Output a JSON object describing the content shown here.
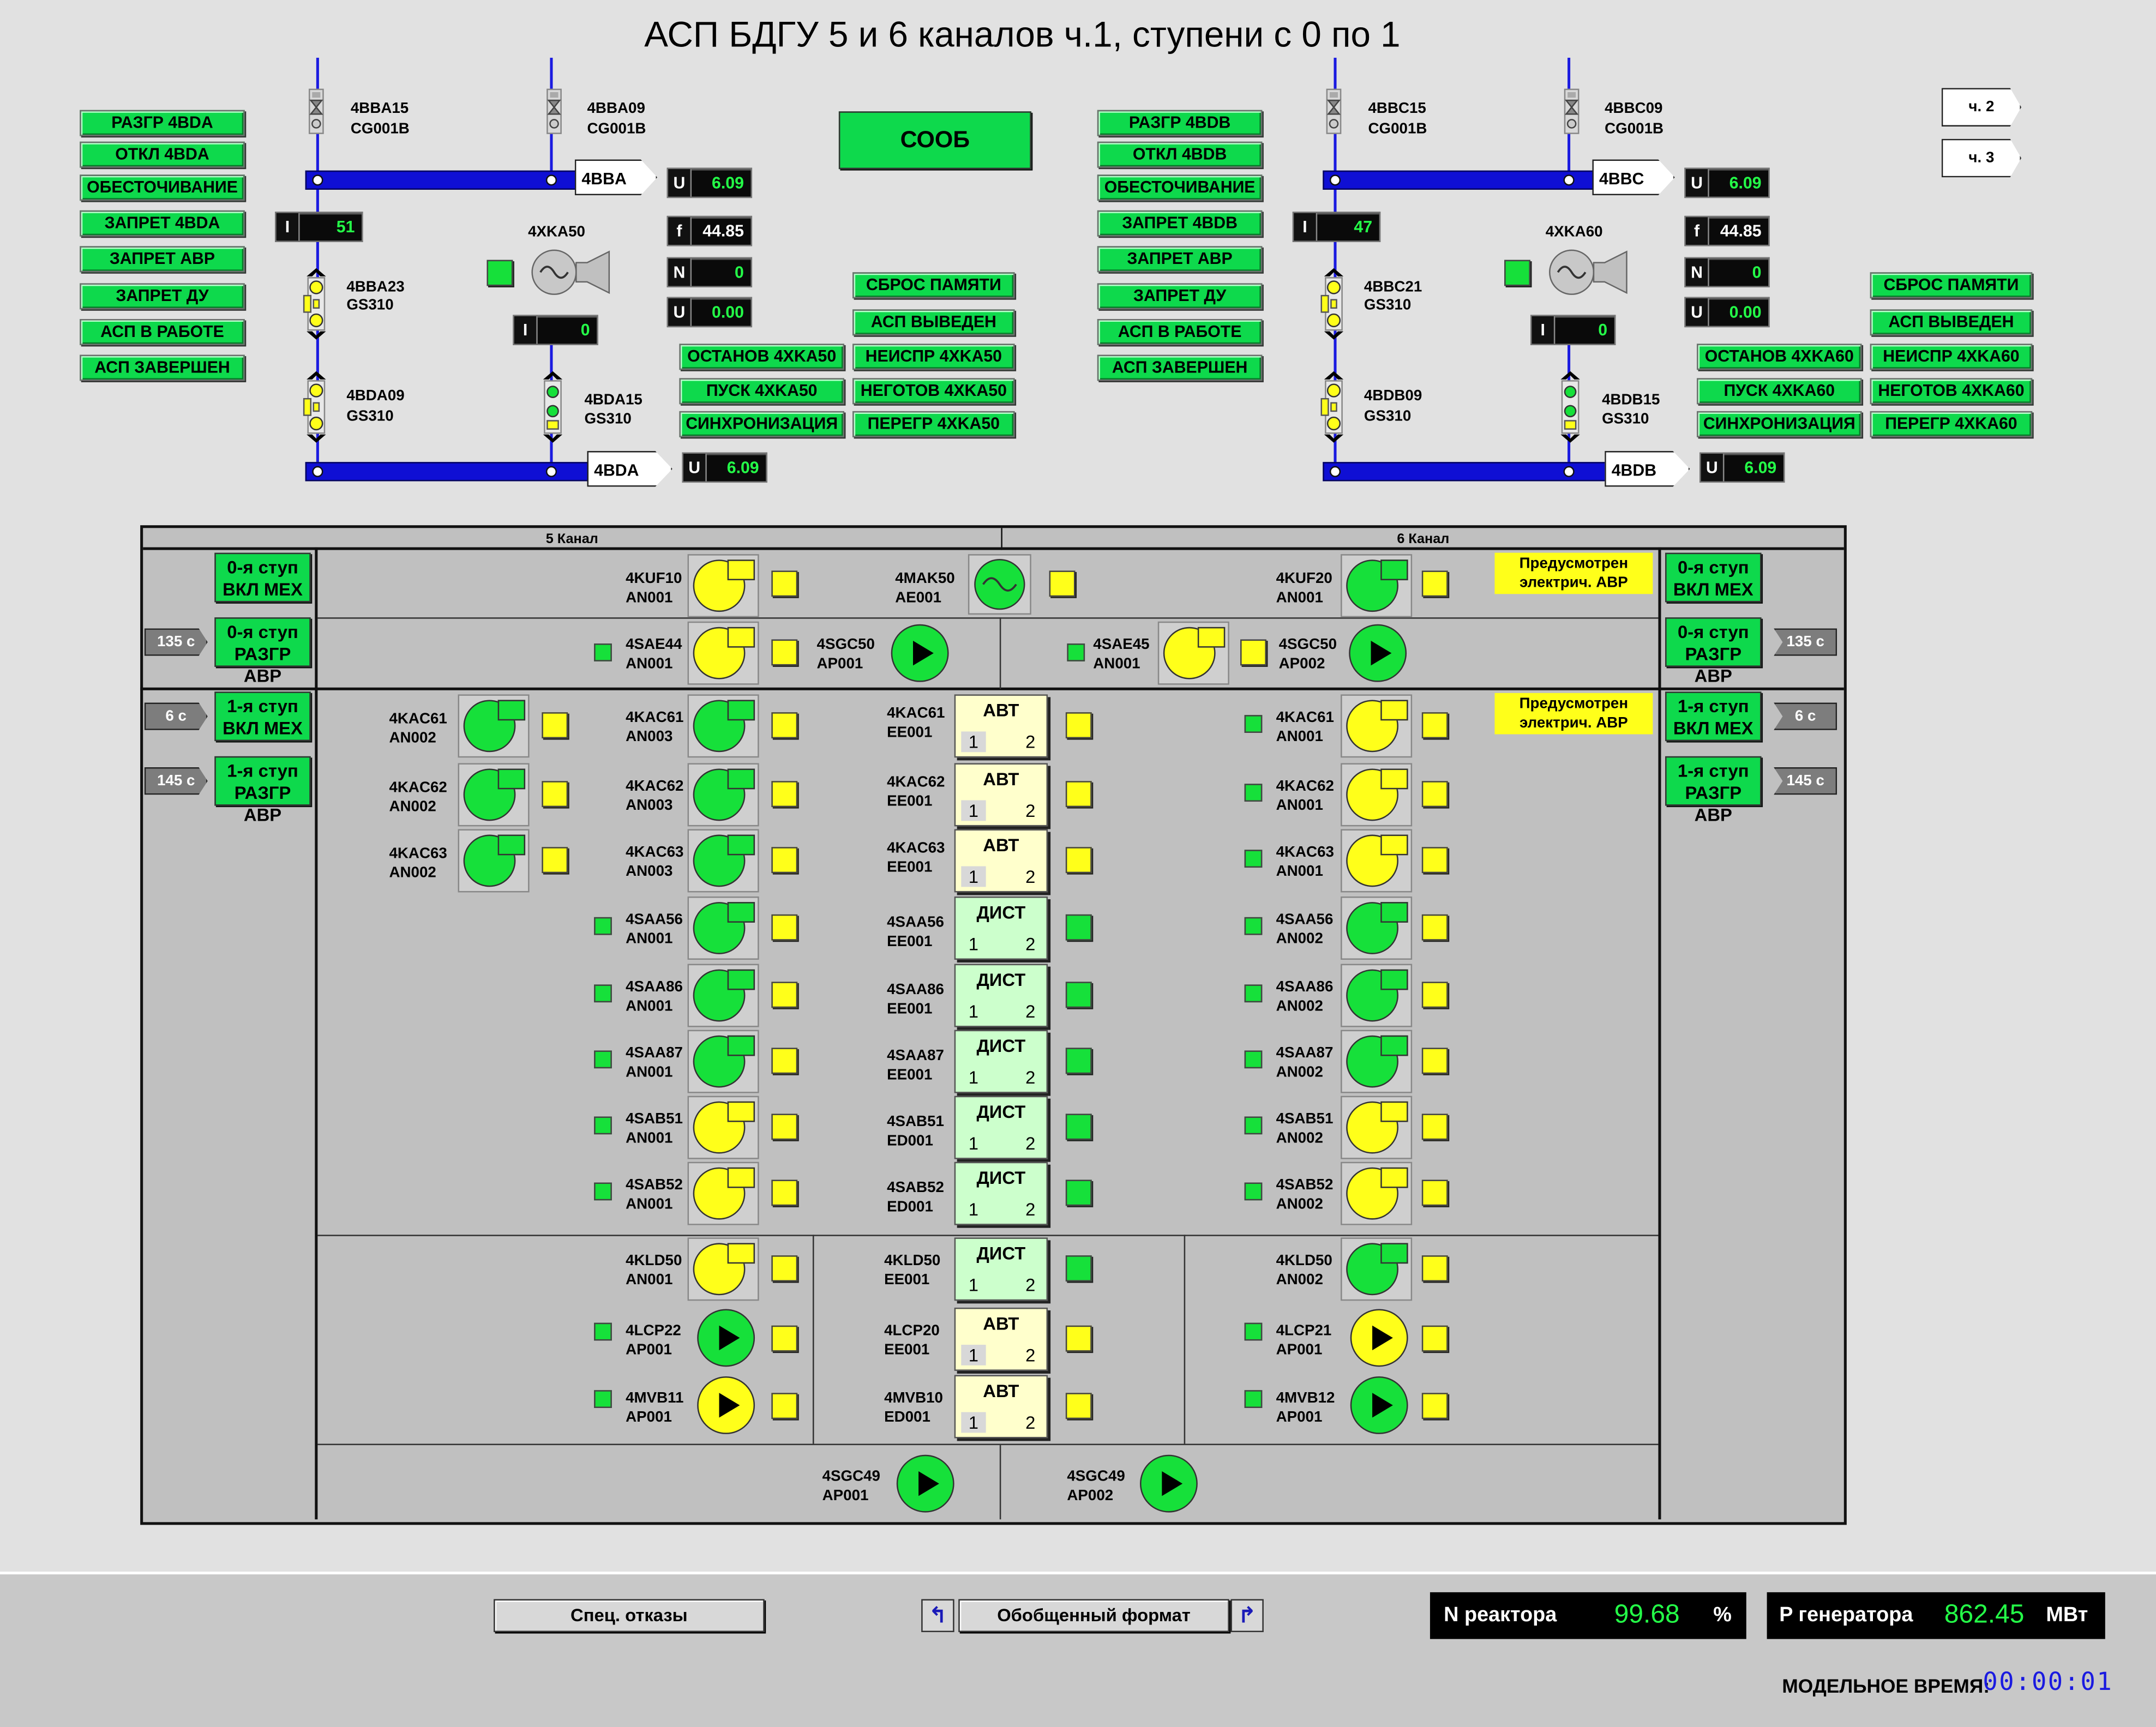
{
  "title": "АСП БДГУ 5 и 6 каналов ч.1, ступени с 0 по 1",
  "sooob": "СООБ",
  "nav": {
    "ch2": "ч. 2",
    "ch3": "ч. 3"
  },
  "left": {
    "buttons": [
      "РАЗГР 4BDA",
      "ОТКЛ 4BDA",
      "ОБЕСТОЧИВАНИЕ",
      "ЗАПРЕТ 4BDA",
      "ЗАПРЕТ АВР",
      "ЗАПРЕТ ДУ",
      "АСП В РАБОТЕ",
      "АСП ЗАВЕРШЕН"
    ],
    "v1": {
      "name": "4BBA15",
      "code": "CG001B"
    },
    "v2": {
      "name": "4BBA09",
      "code": "CG001B"
    },
    "bus_top": "4BBA",
    "bus_bot": "4BDA",
    "U_top": "6.09",
    "U_bot": "6.09",
    "I_left": "51",
    "I_gen": "0",
    "f": "44.85",
    "N": "0",
    "U_gen": "0.00",
    "gen": "4XKA50",
    "b1": {
      "name": "4BBA23",
      "code": "GS310"
    },
    "b2": {
      "name": "4BDA09",
      "code": "GS310"
    },
    "b3": {
      "name": "4BDA15",
      "code": "GS310"
    },
    "right_col": [
      "СБРОС ПАМЯТИ",
      "АСП ВЫВЕДЕН",
      "НЕИСПР 4XKA50",
      "НЕГОТОВ 4XKA50",
      "ПЕРЕГР 4XKA50"
    ],
    "mid_col": [
      "ОСТАНОВ 4XKA50",
      "ПУСК 4XKA50",
      "СИНХРОНИЗАЦИЯ"
    ]
  },
  "right": {
    "buttons": [
      "РАЗГР 4BDB",
      "ОТКЛ 4BDB",
      "ОБЕСТОЧИВАНИЕ",
      "ЗАПРЕТ 4BDB",
      "ЗАПРЕТ АВР",
      "ЗАПРЕТ ДУ",
      "АСП В РАБОТЕ",
      "АСП ЗАВЕРШЕН"
    ],
    "v1": {
      "name": "4BBC15",
      "code": "CG001B"
    },
    "v2": {
      "name": "4BBC09",
      "code": "CG001B"
    },
    "bus_top": "4BBC",
    "bus_bot": "4BDB",
    "U_top": "6.09",
    "U_bot": "6.09",
    "I_left": "47",
    "I_gen": "0",
    "f": "44.85",
    "N": "0",
    "U_gen": "0.00",
    "gen": "4XKA60",
    "b1": {
      "name": "4BBC21",
      "code": "GS310"
    },
    "b2": {
      "name": "4BDB09",
      "code": "GS310"
    },
    "b3": {
      "name": "4BDB15",
      "code": "GS310"
    },
    "right_col": [
      "СБРОС ПАМЯТИ",
      "АСП ВЫВЕДЕН",
      "НЕИСПР 4XKA60",
      "НЕГОТОВ 4XKA60",
      "ПЕРЕГР 4XKA60"
    ],
    "mid_col": [
      "ОСТАНОВ 4XKA60",
      "ПУСК 4XKA60",
      "СИНХРОНИЗАЦИЯ"
    ]
  },
  "panel": {
    "ch5": "5 Канал",
    "ch6": "6 Канал",
    "avr_note": "Предусмотрен электрич. АВР",
    "stage_left": [
      {
        "l1": "0-я ступ",
        "l2": "ВКЛ МЕХ",
        "t": ""
      },
      {
        "l1": "0-я ступ",
        "l2": "РАЗГР АВР",
        "t": "135 с"
      },
      {
        "l1": "1-я ступ",
        "l2": "ВКЛ МЕХ",
        "t": "6 с"
      },
      {
        "l1": "1-я ступ",
        "l2": "РАЗГР АВР",
        "t": "145 с"
      }
    ],
    "stage_right": [
      {
        "l1": "0-я ступ",
        "l2": "ВКЛ МЕХ",
        "t": ""
      },
      {
        "l1": "0-я ступ",
        "l2": "РАЗГР АВР",
        "t": "135 с"
      },
      {
        "l1": "1-я ступ",
        "l2": "ВКЛ МЕХ",
        "t": "6 с"
      },
      {
        "l1": "1-я ступ",
        "l2": "РАЗГР АВР",
        "t": "145 с"
      }
    ],
    "top": [
      {
        "name": "4KUF10",
        "code": "AN001",
        "color": "#ffff1a"
      },
      {
        "name": "4MAK50",
        "code": "AE001"
      },
      {
        "name": "4KUF20",
        "code": "AN001",
        "color": "#16e03a"
      },
      {
        "name": "4SAE44",
        "code": "AN001",
        "color": "#ffff1a"
      },
      {
        "name": "4SGC50",
        "code": "AP001",
        "color": "#16e03a"
      },
      {
        "name": "4SAE45",
        "code": "AN001",
        "color": "#ffff1a"
      },
      {
        "name": "4SGC50",
        "code": "AP002",
        "color": "#16e03a"
      }
    ],
    "kac_left": [
      {
        "name": "4KAC61",
        "code": "AN002"
      },
      {
        "name": "4KAC62",
        "code": "AN002"
      },
      {
        "name": "4KAC63",
        "code": "AN002"
      }
    ],
    "rows": [
      {
        "ln": "4KAC61",
        "lc": "AN003",
        "lcol": "#16e03a",
        "mn": "4KAC61",
        "mc": "EE001",
        "mode": "АВТ",
        "msq": "#ffff1a",
        "rn": "4KAC61",
        "rc": "AN001",
        "rcol": "#ffff1a"
      },
      {
        "ln": "4KAC62",
        "lc": "AN003",
        "lcol": "#16e03a",
        "mn": "4KAC62",
        "mc": "EE001",
        "mode": "АВТ",
        "msq": "#ffff1a",
        "rn": "4KAC62",
        "rc": "AN001",
        "rcol": "#ffff1a"
      },
      {
        "ln": "4KAC63",
        "lc": "AN003",
        "lcol": "#16e03a",
        "mn": "4KAC63",
        "mc": "EE001",
        "mode": "АВТ",
        "msq": "#ffff1a",
        "rn": "4KAC63",
        "rc": "AN001",
        "rcol": "#ffff1a"
      },
      {
        "ln": "4SAA56",
        "lc": "AN001",
        "lcol": "#16e03a",
        "mn": "4SAA56",
        "mc": "EE001",
        "mode": "ДИСТ",
        "msq": "#16e03a",
        "rn": "4SAA56",
        "rc": "AN002",
        "rcol": "#16e03a"
      },
      {
        "ln": "4SAA86",
        "lc": "AN001",
        "lcol": "#16e03a",
        "mn": "4SAA86",
        "mc": "EE001",
        "mode": "ДИСТ",
        "msq": "#16e03a",
        "rn": "4SAA86",
        "rc": "AN002",
        "rcol": "#16e03a"
      },
      {
        "ln": "4SAA87",
        "lc": "AN001",
        "lcol": "#16e03a",
        "mn": "4SAA87",
        "mc": "EE001",
        "mode": "ДИСТ",
        "msq": "#16e03a",
        "rn": "4SAA87",
        "rc": "AN002",
        "rcol": "#16e03a"
      },
      {
        "ln": "4SAB51",
        "lc": "AN001",
        "lcol": "#ffff1a",
        "mn": "4SAB51",
        "mc": "ED001",
        "mode": "ДИСТ",
        "msq": "#16e03a",
        "rn": "4SAB51",
        "rc": "AN002",
        "rcol": "#ffff1a"
      },
      {
        "ln": "4SAB52",
        "lc": "AN001",
        "lcol": "#ffff1a",
        "mn": "4SAB52",
        "mc": "ED001",
        "mode": "ДИСТ",
        "msq": "#16e03a",
        "rn": "4SAB52",
        "rc": "AN002",
        "rcol": "#ffff1a"
      }
    ],
    "lower": [
      {
        "ln": "4KLD50",
        "lc": "AN001",
        "lcol": "#ffff1a",
        "ltype": "pump",
        "mn": "4KLD50",
        "mc": "EE001",
        "mode": "ДИСТ",
        "msq": "#16e03a",
        "rn": "4KLD50",
        "rc": "AN002",
        "rcol": "#16e03a",
        "rtype": "pump"
      },
      {
        "ln": "4LCP22",
        "lc": "AP001",
        "lcol": "#16e03a",
        "ltype": "play",
        "mn": "4LCP20",
        "mc": "EE001",
        "mode": "АВТ",
        "msq": "#ffff1a",
        "rn": "4LCP21",
        "rc": "AP001",
        "rcol": "#ffff1a",
        "rtype": "play"
      },
      {
        "ln": "4MVB11",
        "lc": "AP001",
        "lcol": "#ffff1a",
        "ltype": "play",
        "mn": "4MVB10",
        "mc": "ED001",
        "mode": "АВТ",
        "msq": "#ffff1a",
        "rn": "4MVB12",
        "rc": "AP001",
        "rcol": "#16e03a",
        "rtype": "play"
      }
    ],
    "bottom": [
      {
        "name": "4SGC49",
        "code": "AP001"
      },
      {
        "name": "4SGC49",
        "code": "AP002"
      }
    ],
    "n1": "1",
    "n2": "2"
  },
  "footer": {
    "spec": "Спец. отказы",
    "gen_format": "Обобщенный формат",
    "n_label": "N реактора",
    "n_value": "99.68",
    "n_unit": "%",
    "p_label": "P генератора",
    "p_value": "862.45",
    "p_unit": "МВт",
    "time_label": "МОДЕЛЬНОЕ ВРЕМЯ:",
    "time_value": "00:00:01"
  }
}
